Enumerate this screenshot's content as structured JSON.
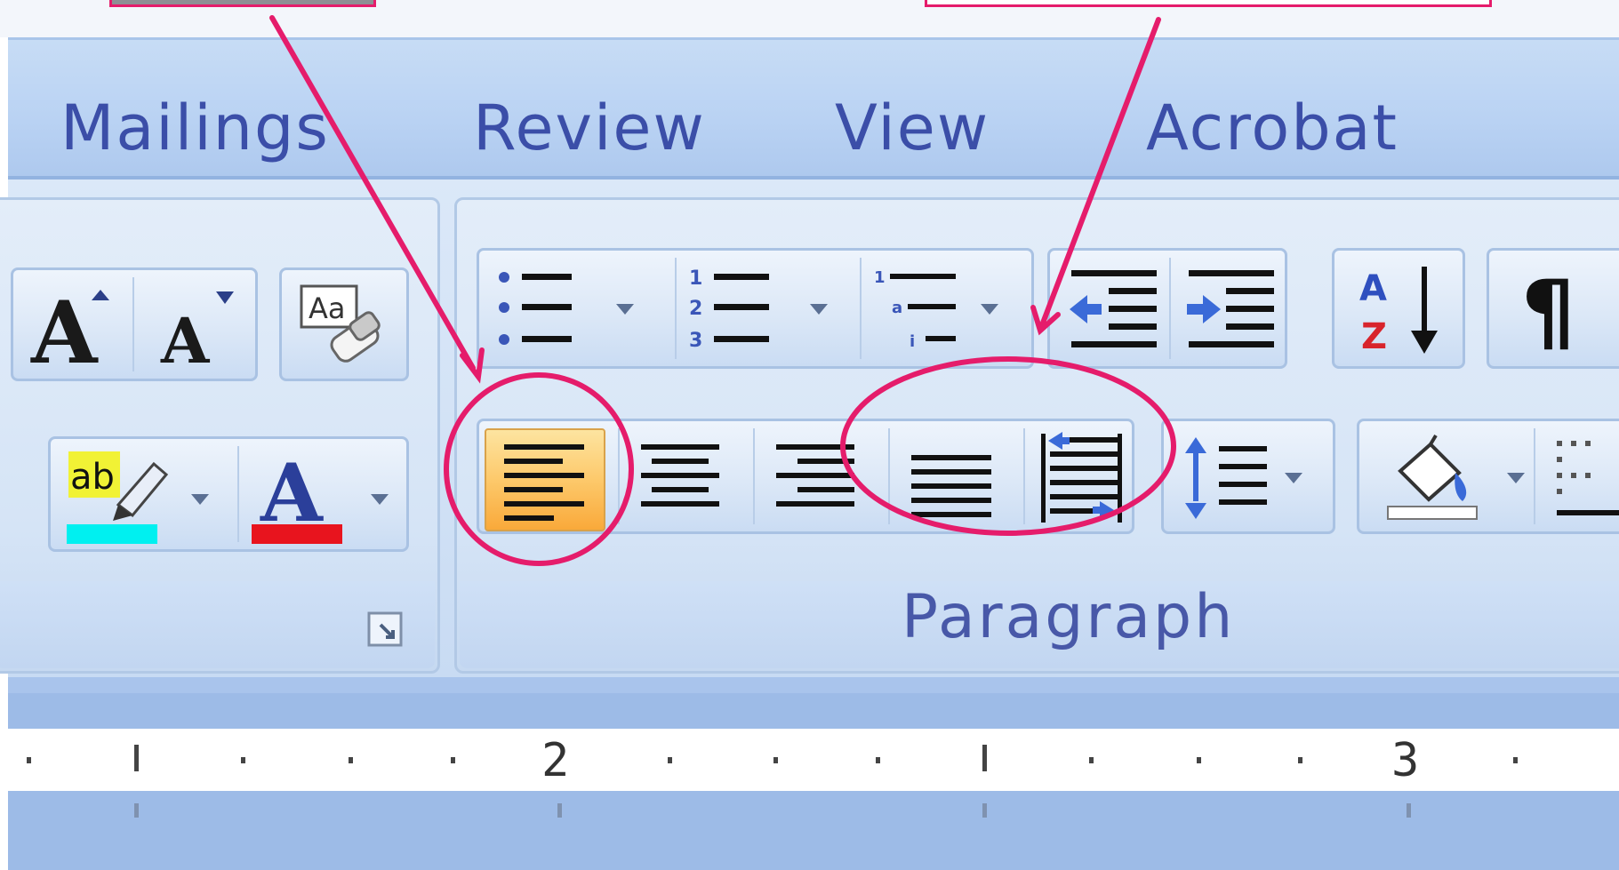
{
  "tabs": [
    {
      "label": "Mailings"
    },
    {
      "label": "Review"
    },
    {
      "label": "View"
    },
    {
      "label": "Acrobat"
    }
  ],
  "groups": {
    "font": {
      "label": ""
    },
    "paragraph": {
      "label": "Paragraph"
    }
  },
  "ruler": {
    "numbers": [
      "2",
      "3"
    ]
  },
  "icons": {
    "grow_font": "grow-font-icon",
    "shrink_font": "shrink-font-icon",
    "clear_formatting": "clear-formatting-icon",
    "highlight": "text-highlight-icon",
    "font_color": "font-color-icon",
    "bullets": "bullets-icon",
    "numbering": "numbering-icon",
    "multilevel": "multilevel-list-icon",
    "decrease_indent": "decrease-indent-icon",
    "increase_indent": "increase-indent-icon",
    "sort": "sort-icon",
    "show_marks": "pilcrow-icon",
    "align_left": "align-left-icon",
    "center": "align-center-icon",
    "align_right": "align-right-icon",
    "justify": "justify-icon",
    "distributed": "distributed-icon",
    "line_spacing": "line-spacing-icon",
    "shading": "shading-icon",
    "borders": "borders-icon"
  },
  "colors": {
    "annotation": "#e51c6b",
    "highlight_color": "#00f0f0",
    "font_color": "#e8141e",
    "active_button": "#fdc96b"
  },
  "state": {
    "active_alignment": "align-left"
  }
}
